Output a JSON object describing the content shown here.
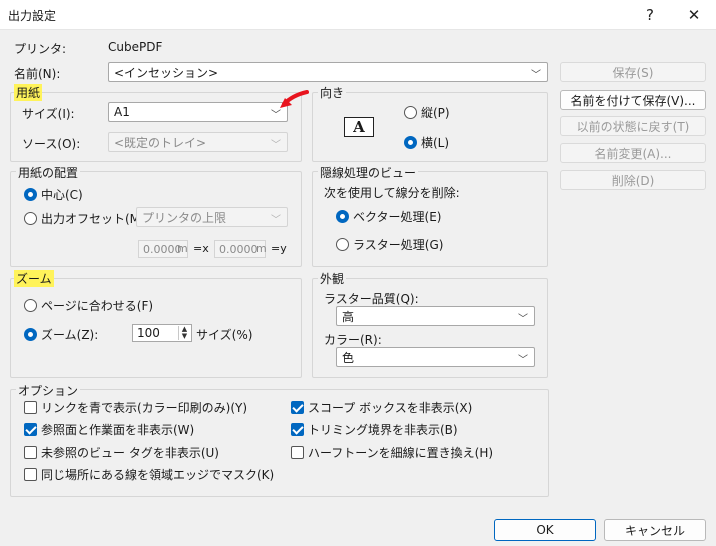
{
  "window": {
    "title": "出力設定",
    "help": "?",
    "close": "✕"
  },
  "printer": {
    "label": "プリンタ:",
    "value": "CubePDF"
  },
  "name": {
    "label": "名前(N):",
    "value": "<インセッション>"
  },
  "side_buttons": {
    "save": "保存(S)",
    "save_as": "名前を付けて保存(V)...",
    "revert": "以前の状態に戻す(T)",
    "rename": "名前変更(A)...",
    "delete": "削除(D)"
  },
  "paper": {
    "legend": "用紙",
    "size_label": "サイズ(I):",
    "size_value": "A1",
    "source_label": "ソース(O):",
    "source_value": "<既定のトレイ>"
  },
  "orientation": {
    "legend": "向き",
    "icon_letter": "A",
    "portrait": "縦(P)",
    "landscape": "横(L)"
  },
  "paper_placement": {
    "legend": "用紙の配置",
    "center": "中心(C)",
    "offset": "出力オフセット(M):",
    "offset_value": "プリンタの上限",
    "x_value": "0.0000",
    "x_unit": "m",
    "x_suffix": "=x",
    "y_value": "0.0000",
    "y_unit": "m",
    "y_suffix": "=y"
  },
  "hidden_line": {
    "legend": "隠線処理のビュー",
    "caption": "次を使用して線分を削除:",
    "vector": "ベクター処理(E)",
    "raster": "ラスター処理(G)"
  },
  "zoom": {
    "legend": "ズーム",
    "fit": "ページに合わせる(F)",
    "zoom_label": "ズーム(Z):",
    "zoom_value": "100",
    "size_suffix": "サイズ(%)"
  },
  "appearance": {
    "legend": "外観",
    "raster_label": "ラスター品質(Q):",
    "raster_value": "高",
    "color_label": "カラー(R):",
    "color_value": "色"
  },
  "options": {
    "legend": "オプション",
    "left": [
      {
        "label": "リンクを青で表示(カラー印刷のみ)(Y)",
        "checked": false
      },
      {
        "label": "参照面と作業面を非表示(W)",
        "checked": true
      },
      {
        "label": "未参照のビュー タグを非表示(U)",
        "checked": false
      },
      {
        "label": "同じ場所にある線を領域エッジでマスク(K)",
        "checked": false
      }
    ],
    "right": [
      {
        "label": "スコープ ボックスを非表示(X)",
        "checked": true
      },
      {
        "label": "トリミング境界を非表示(B)",
        "checked": true
      },
      {
        "label": "ハーフトーンを細線に置き換え(H)",
        "checked": false
      }
    ]
  },
  "footer": {
    "ok": "OK",
    "cancel": "キャンセル"
  },
  "colors": {
    "accent": "#0067c0",
    "highlight": "#fff35a",
    "annotation_arrow": "#e8141e"
  }
}
